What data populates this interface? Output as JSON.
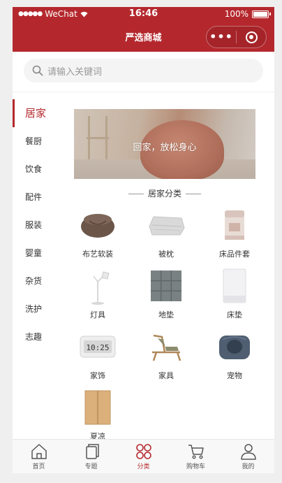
{
  "status": {
    "carrier": "WeChat",
    "time": "16:46",
    "battery": "100%",
    "battery_level": 1.0
  },
  "nav": {
    "title": "严选商城"
  },
  "search": {
    "placeholder": "请输入关键词"
  },
  "sidebar": {
    "items": [
      {
        "label": "居家",
        "active": true
      },
      {
        "label": "餐厨"
      },
      {
        "label": "饮食"
      },
      {
        "label": "配件"
      },
      {
        "label": "服装"
      },
      {
        "label": "婴童"
      },
      {
        "label": "杂货"
      },
      {
        "label": "洗护"
      },
      {
        "label": "志趣"
      }
    ]
  },
  "banner": {
    "text": "回家，放松身心"
  },
  "category": {
    "title": "居家分类",
    "items": [
      {
        "label": "布艺软装",
        "icon": "beanbag-icon"
      },
      {
        "label": "被枕",
        "icon": "pillow-icon"
      },
      {
        "label": "床品件套",
        "icon": "bedding-set-icon"
      },
      {
        "label": "灯具",
        "icon": "lamp-icon"
      },
      {
        "label": "地垫",
        "icon": "floor-mat-icon"
      },
      {
        "label": "床垫",
        "icon": "mattress-icon"
      },
      {
        "label": "家饰",
        "icon": "clock-icon"
      },
      {
        "label": "家具",
        "icon": "chair-icon"
      },
      {
        "label": "宠物",
        "icon": "pet-bed-icon"
      },
      {
        "label": "夏凉",
        "icon": "summer-mat-icon"
      }
    ]
  },
  "tabbar": {
    "items": [
      {
        "label": "首页",
        "icon": "home-icon"
      },
      {
        "label": "专题",
        "icon": "topic-icon"
      },
      {
        "label": "分类",
        "icon": "category-icon",
        "active": true
      },
      {
        "label": "购物车",
        "icon": "cart-icon"
      },
      {
        "label": "我的",
        "icon": "profile-icon"
      }
    ]
  },
  "colors": {
    "brand": "#b4282d",
    "text": "#333333",
    "muted": "#999999"
  }
}
